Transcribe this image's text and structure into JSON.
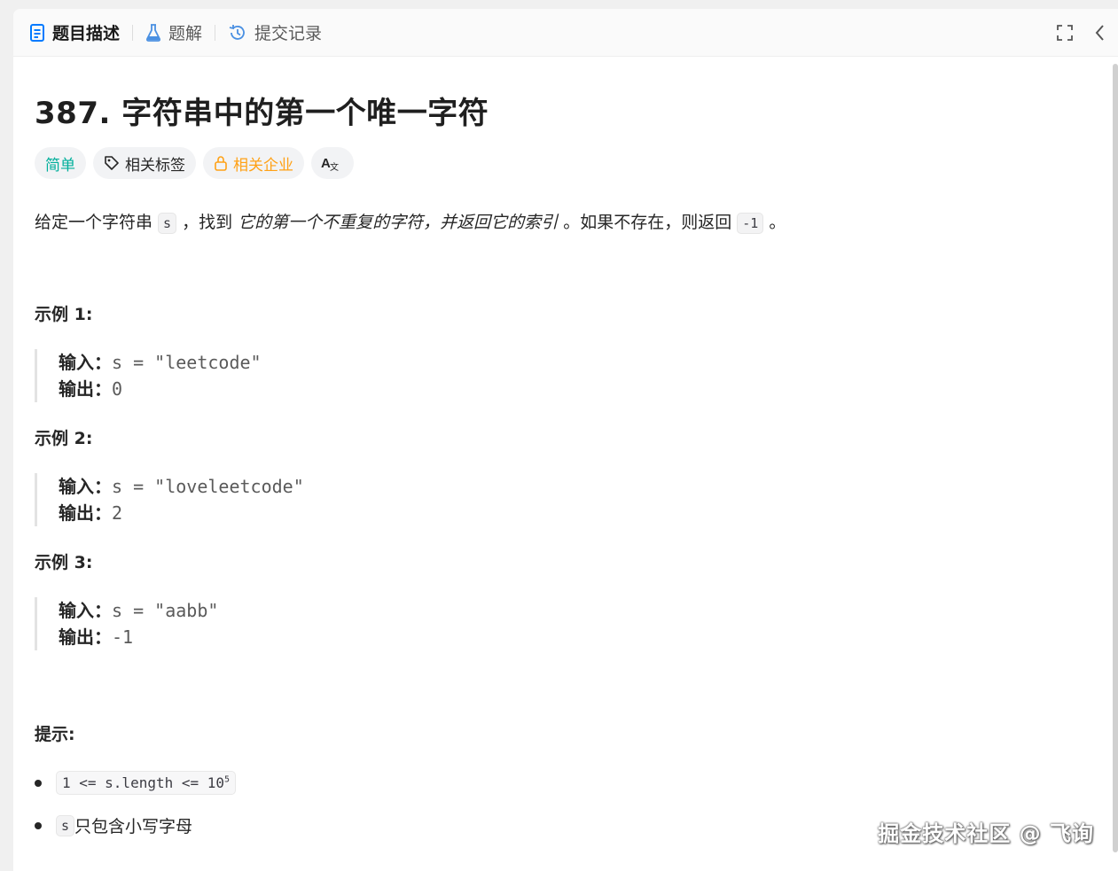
{
  "tabs": [
    {
      "label": "题目描述",
      "icon": "document-icon",
      "active": true
    },
    {
      "label": "题解",
      "icon": "flask-icon",
      "active": false
    },
    {
      "label": "提交记录",
      "icon": "history-icon",
      "active": false
    }
  ],
  "problem": {
    "title": "387. 字符串中的第一个唯一字符",
    "tags": {
      "difficulty": "简单",
      "related_tags": "相关标签",
      "related_companies": "相关企业",
      "translate_icon": "translate-icon"
    },
    "description": {
      "p1": "给定一个字符串 ",
      "code_s": "s",
      "p2": " ，找到 ",
      "italic": "它的第一个不重复的字符，并返回它的索引",
      "p3": " 。如果不存在，则返回 ",
      "code_neg": "-1",
      "p4": " 。"
    },
    "examples": [
      {
        "title": "示例 1:",
        "input_label": "输入：",
        "input": "s = \"leetcode\"",
        "output_label": "输出：",
        "output": "0"
      },
      {
        "title": "示例 2:",
        "input_label": "输入：",
        "input": "s = \"loveleetcode\"",
        "output_label": "输出：",
        "output": "2"
      },
      {
        "title": "示例 3:",
        "input_label": "输入：",
        "input": "s = \"aabb\"",
        "output_label": "输出：",
        "output": "-1"
      }
    ],
    "hints": {
      "title": "提示:",
      "h1_code": "1 <= s.length <= 10",
      "h1_sup": "5",
      "h2_code": "s",
      "h2_text": " 只包含小写字母"
    }
  },
  "watermark": "掘金技术社区 @ 飞询",
  "colors": {
    "easy": "#00af9b",
    "company": "#ffa116",
    "accent": "#007aff"
  }
}
